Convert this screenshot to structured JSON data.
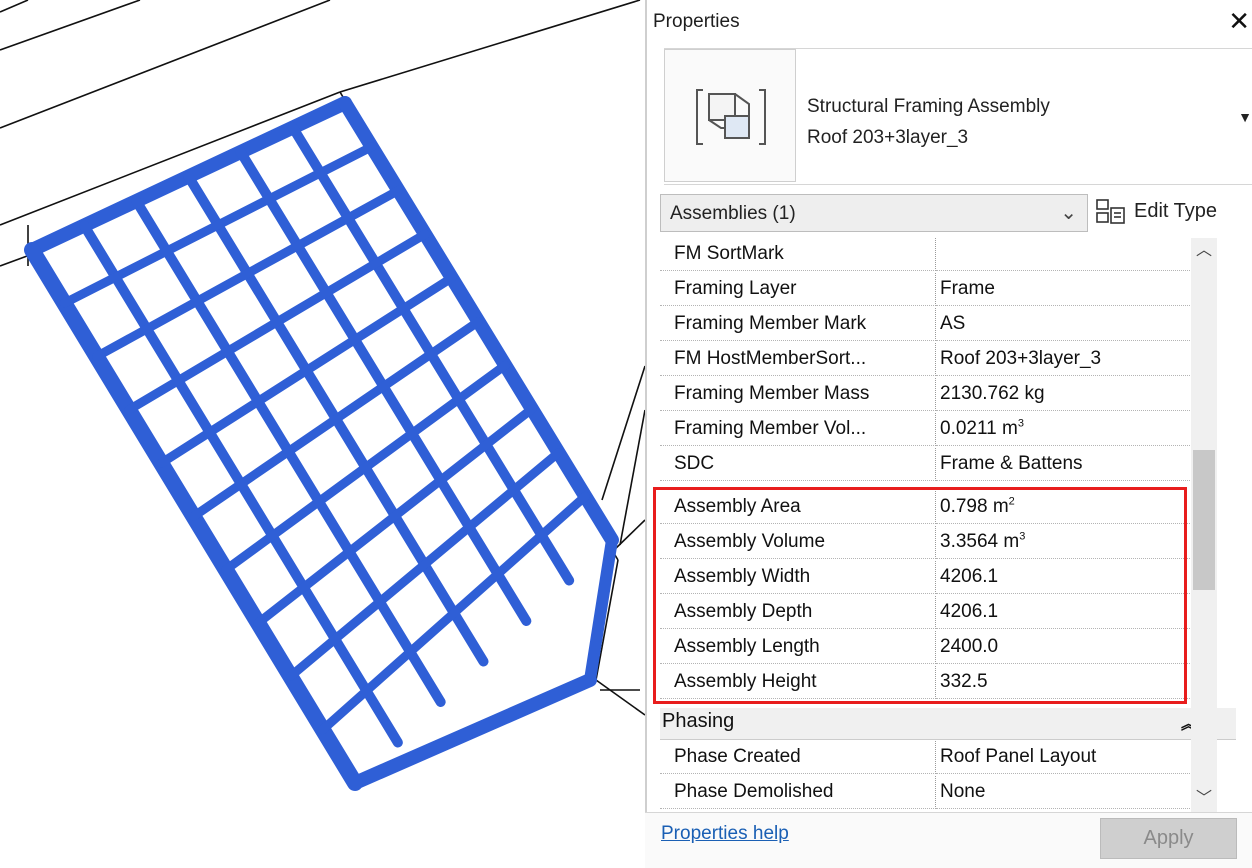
{
  "panel": {
    "title": "Properties",
    "close_icon": "close-icon"
  },
  "type_selector": {
    "icon": "assembly-icon",
    "family": "Structural Framing Assembly",
    "type": "Roof 203+3layer_3"
  },
  "filter": {
    "selected": "Assemblies (1)",
    "edit_type_label": "Edit Type"
  },
  "properties": {
    "rows": [
      {
        "name": "FM SortMark",
        "value": ""
      },
      {
        "name": "Framing Layer",
        "value": "Frame"
      },
      {
        "name": "Framing Member Mark",
        "value": "AS"
      },
      {
        "name": "FM HostMemberSort...",
        "value": "Roof 203+3layer_3"
      },
      {
        "name": "Framing Member Mass",
        "value": "2130.762 kg"
      },
      {
        "name": "Framing Member Vol...",
        "value": "0.0211 m",
        "unit_sup": "3"
      },
      {
        "name": "SDC",
        "value": "Frame & Battens"
      },
      {
        "name": "Assembly Area",
        "value": "0.798 m",
        "unit_sup": "2"
      },
      {
        "name": "Assembly Volume",
        "value": "3.3564 m",
        "unit_sup": "3"
      },
      {
        "name": "Assembly Width",
        "value": "4206.1"
      },
      {
        "name": "Assembly Depth",
        "value": "4206.1"
      },
      {
        "name": "Assembly Length",
        "value": "2400.0"
      },
      {
        "name": "Assembly Height",
        "value": "332.5"
      }
    ],
    "group": {
      "label": "Phasing"
    },
    "phasing_rows": [
      {
        "name": "Phase Created",
        "value": "Roof Panel Layout"
      },
      {
        "name": "Phase Demolished",
        "value": "None"
      }
    ]
  },
  "footer": {
    "help_link": "Properties help",
    "apply_label": "Apply"
  },
  "colors": {
    "highlight": "#e81d1d",
    "framing": "#2f5fd6",
    "link": "#1a5fb4"
  }
}
